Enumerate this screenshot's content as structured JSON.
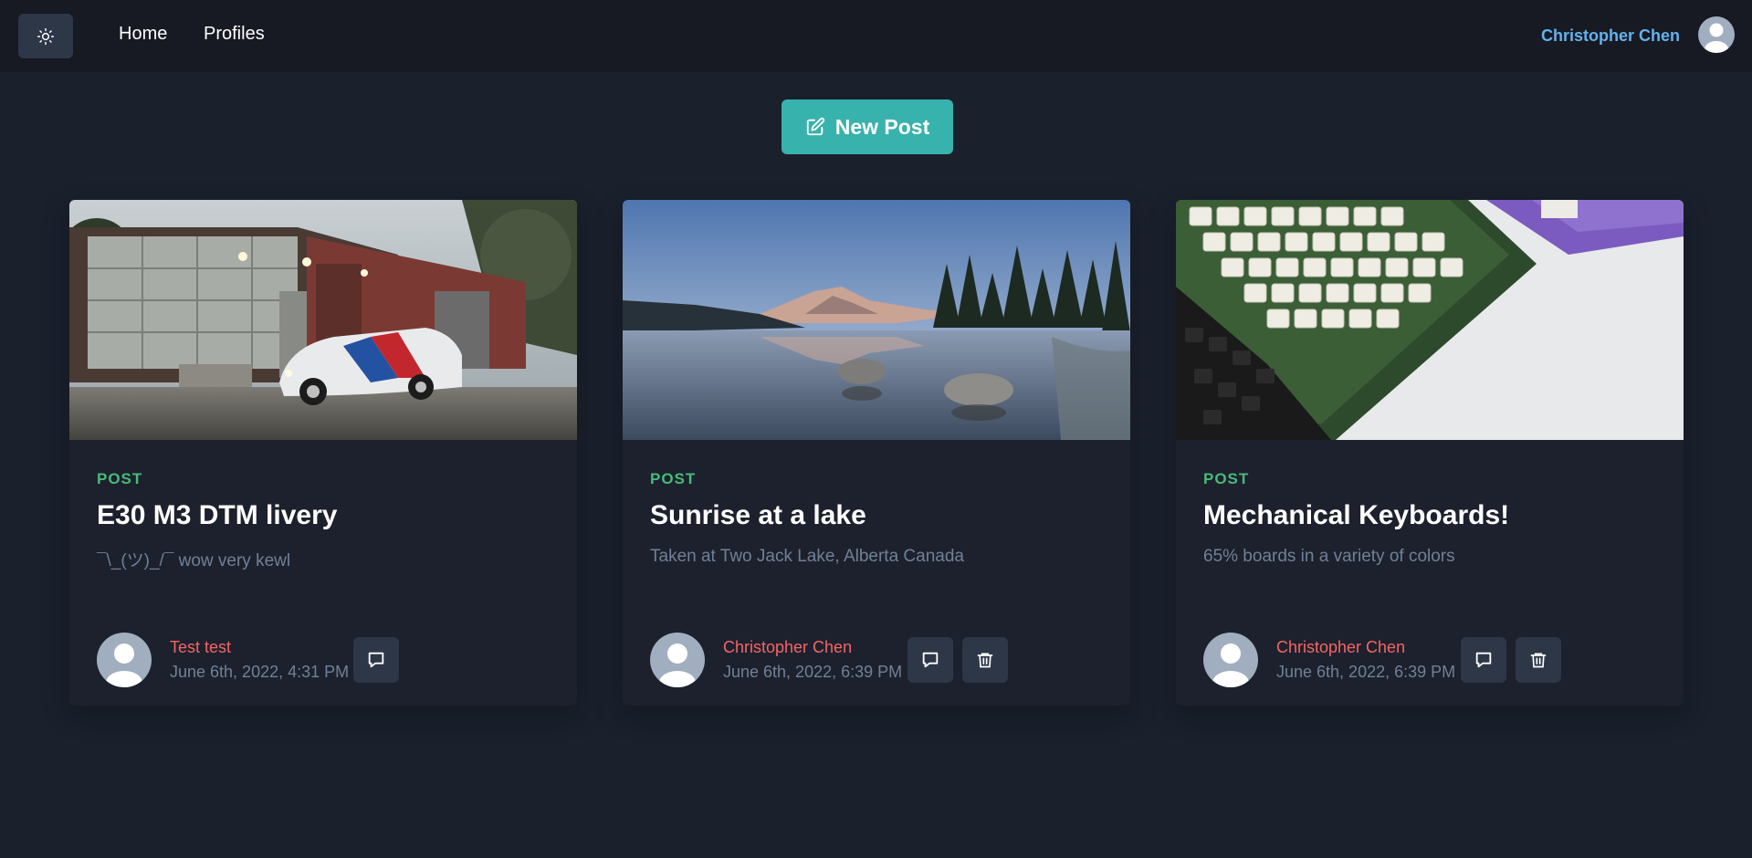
{
  "nav": {
    "home": "Home",
    "profiles": "Profiles",
    "user_name": "Christopher Chen",
    "theme_icon": "sun-icon"
  },
  "actions": {
    "new_post": "New Post"
  },
  "colors": {
    "background": "#1a202c",
    "topbar": "#171923",
    "accent": "#38b2ac",
    "user_link": "#63b3ed",
    "post_type": "#48bb78",
    "author": "#f56565",
    "muted": "#718096"
  },
  "posts": [
    {
      "type": "POST",
      "title": "E30 M3 DTM livery",
      "description": "¯\\_(ツ)_/¯ wow very kewl",
      "author": "Test test",
      "date": "June 6th, 2022, 4:31 PM",
      "image": "car-photo",
      "actions": [
        "comment-icon"
      ]
    },
    {
      "type": "POST",
      "title": "Sunrise at a lake",
      "description": "Taken at Two Jack Lake, Alberta Canada",
      "author": "Christopher Chen",
      "date": "June 6th, 2022, 6:39 PM",
      "image": "lake-photo",
      "actions": [
        "comment-icon",
        "trash-icon"
      ]
    },
    {
      "type": "POST",
      "title": "Mechanical Keyboards!",
      "description": "65% boards in a variety of colors",
      "author": "Christopher Chen",
      "date": "June 6th, 2022, 6:39 PM",
      "image": "keyboard-photo",
      "actions": [
        "comment-icon",
        "trash-icon"
      ]
    }
  ]
}
